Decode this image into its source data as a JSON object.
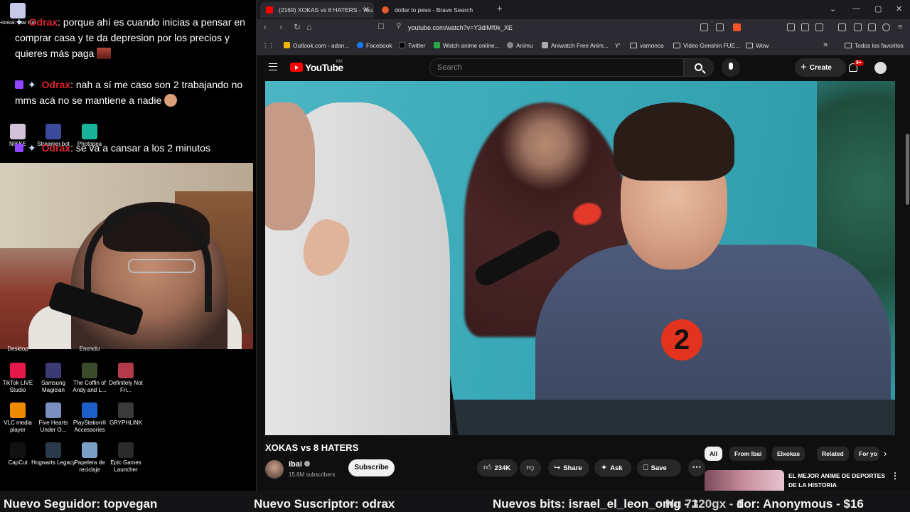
{
  "stream_overlay": {
    "chat": [
      {
        "user": "Odrax",
        "text": ": porque ahí es cuando inicias a pensar en comprar casa y te da depresion por los precios y quieres más paga"
      },
      {
        "user": "Odrax",
        "text": ": nah a sí me caso son 2 trabajando no mms acá no se mantiene a nadie"
      },
      {
        "user": "Odrax",
        "text": ": se va a cansar a los 2 minutos"
      }
    ],
    "desktop_icons_top": [
      {
        "label": "Honkai: Star Rail",
        "color": "#c8c8e8"
      },
      {
        "label": "NIKKE",
        "color": "#d0c2d8"
      },
      {
        "label": "Streamer.bot",
        "color": "#3b4a9a"
      },
      {
        "label": "Photopea",
        "color": "#19b39a"
      }
    ],
    "desktop_icons_partial": [
      {
        "label": "Desktop"
      },
      {
        "label": "Encnclu"
      }
    ],
    "desktop_icons": [
      {
        "label": "TikTok LIVE Studio",
        "color": "#e5184b"
      },
      {
        "label": "Samsung Magician",
        "color": "#3b3a73"
      },
      {
        "label": "The Coffin of Andy and L...",
        "color": "#3a4a2a"
      },
      {
        "label": "Definitely Not Fri...",
        "color": "#b33a4a"
      },
      {
        "label": "VLC media player",
        "color": "#f08a00"
      },
      {
        "label": "Five Hearts Under O...",
        "color": "#7a8fc0"
      },
      {
        "label": "PlayStation® Accessories",
        "color": "#1d5fc7"
      },
      {
        "label": "GRYPHLINK",
        "color": "#3a3a3a"
      },
      {
        "label": "CapCut",
        "color": "#111111"
      },
      {
        "label": "Hogwarts Legacy",
        "color": "#2a3a4a"
      },
      {
        "label": "Papelera de reciclaje",
        "color": "#7aa0c8"
      },
      {
        "label": "Epic Games Launcher",
        "color": "#2a2a2a"
      }
    ]
  },
  "browser": {
    "tabs": [
      {
        "title": "(2169) XOKAS vs 8 HATERS - You",
        "active": true,
        "icon_color": "#ff0000"
      },
      {
        "title": "dollar to peso - Brave Search",
        "active": false,
        "icon_color": "#e05a2a"
      }
    ],
    "new_tab": "+",
    "window_controls": [
      "⌄",
      "—",
      "▢",
      "✕"
    ],
    "url": "youtube.com/watch?v=Y3diMf0k_XE",
    "bookmarks": [
      {
        "label": "Outlook.com - adan...",
        "icon": "outlook-icon",
        "color": "#f3b800"
      },
      {
        "label": "Facebook",
        "icon": "facebook-icon",
        "color": "#1877f2"
      },
      {
        "label": "Twitter",
        "icon": "x-icon",
        "color": "#000000"
      },
      {
        "label": "Watch anime online...",
        "icon": "anime-icon",
        "color": "#2aa84a"
      },
      {
        "label": "Animu",
        "icon": "globe-icon",
        "color": "#888888"
      },
      {
        "label": "Aniwatch Free Anim...",
        "icon": "aniwatch-icon",
        "color": "#aaaaaa"
      },
      {
        "label": "Y'",
        "icon": "ytmusic-icon",
        "color": "#666666"
      },
      {
        "label": "vamonos",
        "icon": "folder-icon",
        "color": ""
      },
      {
        "label": "Video Genshin FUE...",
        "icon": "folder-icon",
        "color": ""
      },
      {
        "label": "Wow",
        "icon": "folder-icon",
        "color": ""
      }
    ],
    "bookmarks_overflow": "»",
    "all_bookmarks": "Todos los favoritos"
  },
  "youtube": {
    "logo_text": "YouTube",
    "country_code": "MX",
    "search_placeholder": "Search",
    "create_label": "Create",
    "notifications": "9+",
    "video": {
      "title": "XOKAS vs 8 HATERS",
      "channel": "Ibai",
      "subscribers": "15.6M subscribers",
      "subscribe_label": "Subscribe",
      "likes": "234K",
      "share_label": "Share",
      "ask_label": "Ask",
      "save_label": "Save",
      "player_number": "2"
    },
    "chips": [
      "All",
      "From Ibai",
      "Elxokas",
      "Related",
      "For yo"
    ],
    "recommendation": {
      "title": "EL MEJOR ANIME DE DEPORTES DE LA HISTORIA"
    }
  },
  "ticker": {
    "follower": "Nuevo Seguidor: topvegan",
    "subscriber": "Nuevo Suscriptor: odrax",
    "bits": "Nuevos bits: israel_el_leon_omg - 1",
    "overlap": "Nu 7320gx - 1",
    "donor": "dor: Anonymous - $16"
  },
  "colors": {
    "chat_name": "#e0222d",
    "yt_red": "#ff0000",
    "badge_red": "#cc0000"
  }
}
